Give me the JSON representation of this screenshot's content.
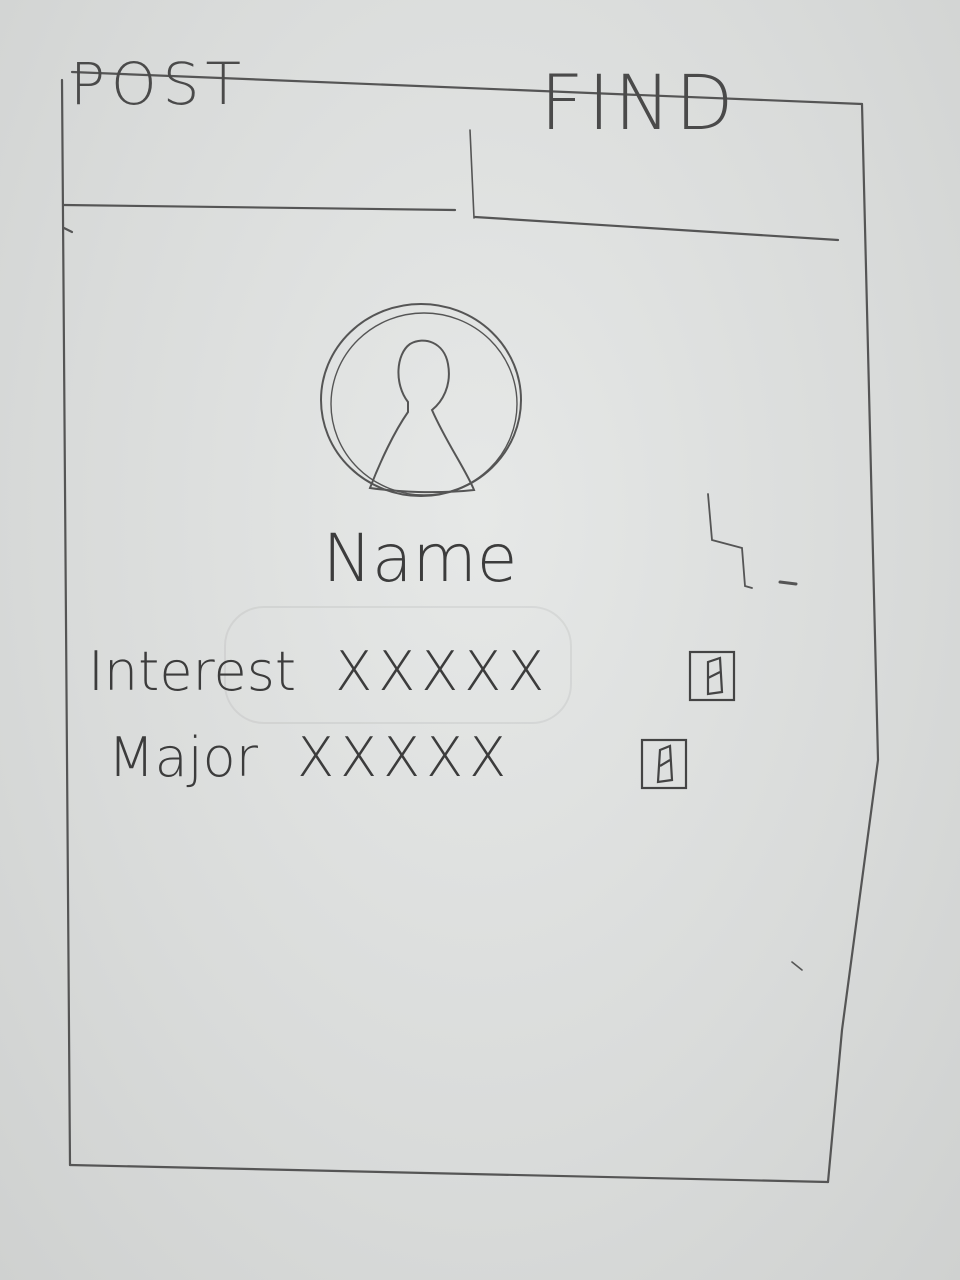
{
  "tabs": [
    {
      "label": "POST"
    },
    {
      "label": "FIND"
    }
  ],
  "profile": {
    "name": "Name",
    "fields": [
      {
        "label": "Interest",
        "value": "XXXXX"
      },
      {
        "label": "Major",
        "value": "XXXXX"
      }
    ]
  },
  "icons": {
    "avatar": "user-avatar-icon",
    "edit": "pencil-edit-icon"
  },
  "colors": {
    "paper": "#dcdedd",
    "pencil": "#3c3c3c"
  }
}
